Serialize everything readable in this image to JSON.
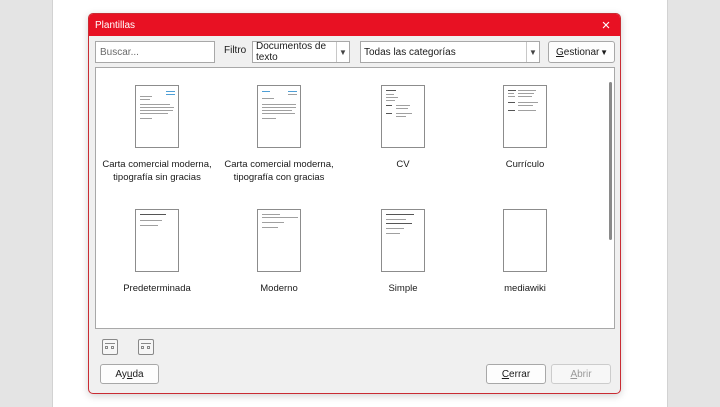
{
  "dialog": {
    "title": "Plantillas",
    "close_symbol": "×"
  },
  "toolbar": {
    "search_placeholder": "Buscar...",
    "filter_label": "Filtro",
    "doc_type_value": "Documentos de texto",
    "category_value": "Todas las categorías",
    "manage_label_mnemonic": "G",
    "manage_label_rest": "estionar"
  },
  "templates": [
    {
      "label_line1": "Carta comercial moderna,",
      "label_line2": "tipografía sin gracias"
    },
    {
      "label_line1": "Carta comercial moderna,",
      "label_line2": "tipografía con gracias"
    },
    {
      "label_line1": "CV",
      "label_line2": ""
    },
    {
      "label_line1": "Currículo",
      "label_line2": ""
    },
    {
      "label_line1": "Predeterminada",
      "label_line2": ""
    },
    {
      "label_line1": "Moderno",
      "label_line2": ""
    },
    {
      "label_line1": "Simple",
      "label_line2": ""
    },
    {
      "label_line1": "mediawiki",
      "label_line2": ""
    }
  ],
  "view_icons": [
    "thumbnail-view-icon",
    "list-view-icon"
  ],
  "footer": {
    "help_pre": "Ay",
    "help_mnemonic": "u",
    "help_post": "da",
    "close_mnemonic": "C",
    "close_rest": "errar",
    "open_mnemonic": "A",
    "open_rest": "brir"
  },
  "colors": {
    "titlebar": "#e81123",
    "dialog_bg": "#f0f0f0"
  }
}
